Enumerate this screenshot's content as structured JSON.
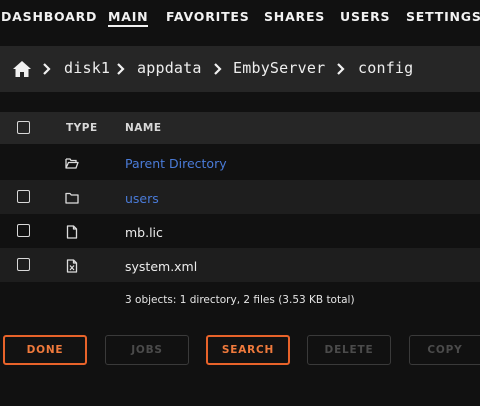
{
  "nav": {
    "items": [
      {
        "label": "DASHBOARD",
        "active": false
      },
      {
        "label": "MAIN",
        "active": true
      },
      {
        "label": "FAVORITES",
        "active": false
      },
      {
        "label": "SHARES",
        "active": false
      },
      {
        "label": "USERS",
        "active": false
      },
      {
        "label": "SETTINGS",
        "active": false
      }
    ]
  },
  "breadcrumb": {
    "home_icon": "home-icon",
    "separator_icon": "chevron-right-icon",
    "parts": [
      "disk1",
      "appdata",
      "EmbyServer",
      "config"
    ]
  },
  "table": {
    "headers": {
      "type": "TYPE",
      "name": "NAME"
    },
    "rows": [
      {
        "icon": "folder-open-icon",
        "name": "Parent Directory",
        "link": true,
        "checkbox": false
      },
      {
        "icon": "folder-icon",
        "name": "users",
        "link": true,
        "checkbox": true
      },
      {
        "icon": "file-icon",
        "name": "mb.lic",
        "link": false,
        "checkbox": true
      },
      {
        "icon": "xml-file-icon",
        "name": "system.xml",
        "link": false,
        "checkbox": true
      }
    ],
    "summary": "3 objects: 1 directory, 2 files (3.53 KB total)"
  },
  "buttons": {
    "done": "DONE",
    "jobs": "JOBS",
    "search": "SEARCH",
    "delete": "DELETE",
    "copy": "COPY"
  },
  "colors": {
    "accent": "#e8632a",
    "link": "#4a7bd8",
    "background": "#111111",
    "bar": "#262626"
  }
}
